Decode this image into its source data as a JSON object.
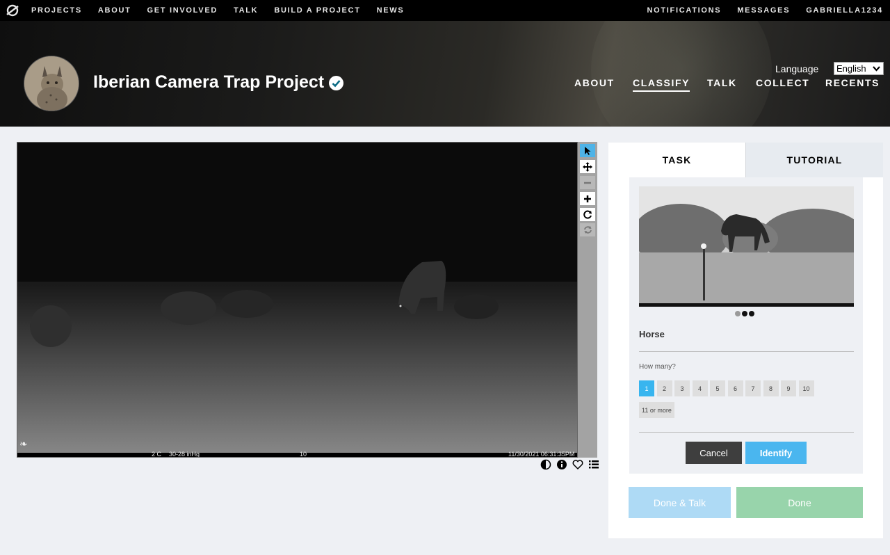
{
  "topnav": {
    "logo": "zooniverse-logo-icon",
    "links": [
      "PROJECTS",
      "ABOUT",
      "GET INVOLVED",
      "TALK",
      "BUILD A PROJECT",
      "NEWS"
    ],
    "right": [
      "NOTIFICATIONS",
      "MESSAGES",
      "GABRIELLA1234"
    ]
  },
  "project": {
    "title": "Iberian Camera Trap Project",
    "verified_icon": "verified-check-icon",
    "language_label": "Language",
    "language_value": "English",
    "nav": [
      "ABOUT",
      "CLASSIFY",
      "TALK",
      "COLLECT",
      "RECENTS"
    ],
    "active_nav": "CLASSIFY"
  },
  "viewer": {
    "footer": {
      "temp": "2 C",
      "pressure": "30-28 inHg",
      "camera_id": "10",
      "datetime": "11/30/2021 06:31:35PM"
    },
    "tools": [
      "pointer-icon",
      "pan-icon",
      "zoom-out-icon",
      "zoom-in-icon",
      "rotate-icon",
      "reset-icon"
    ],
    "meta_icons": [
      "invert-icon",
      "info-icon",
      "favorite-heart-icon",
      "collections-list-icon"
    ]
  },
  "task_panel": {
    "tabs": [
      "TASK",
      "TUTORIAL"
    ],
    "active_tab": "TASK",
    "choice_name": "Horse",
    "question": "How many?",
    "answers": [
      "1",
      "2",
      "3",
      "4",
      "5",
      "6",
      "7",
      "8",
      "9",
      "10",
      "11 or more"
    ],
    "selected_answer": "1",
    "cancel_label": "Cancel",
    "identify_label": "Identify",
    "done_talk_label": "Done & Talk",
    "done_label": "Done"
  },
  "colors": {
    "accent": "#38b5ef",
    "done": "#98d4ab",
    "done_talk": "#aedaf5",
    "topbar": "#000000"
  }
}
